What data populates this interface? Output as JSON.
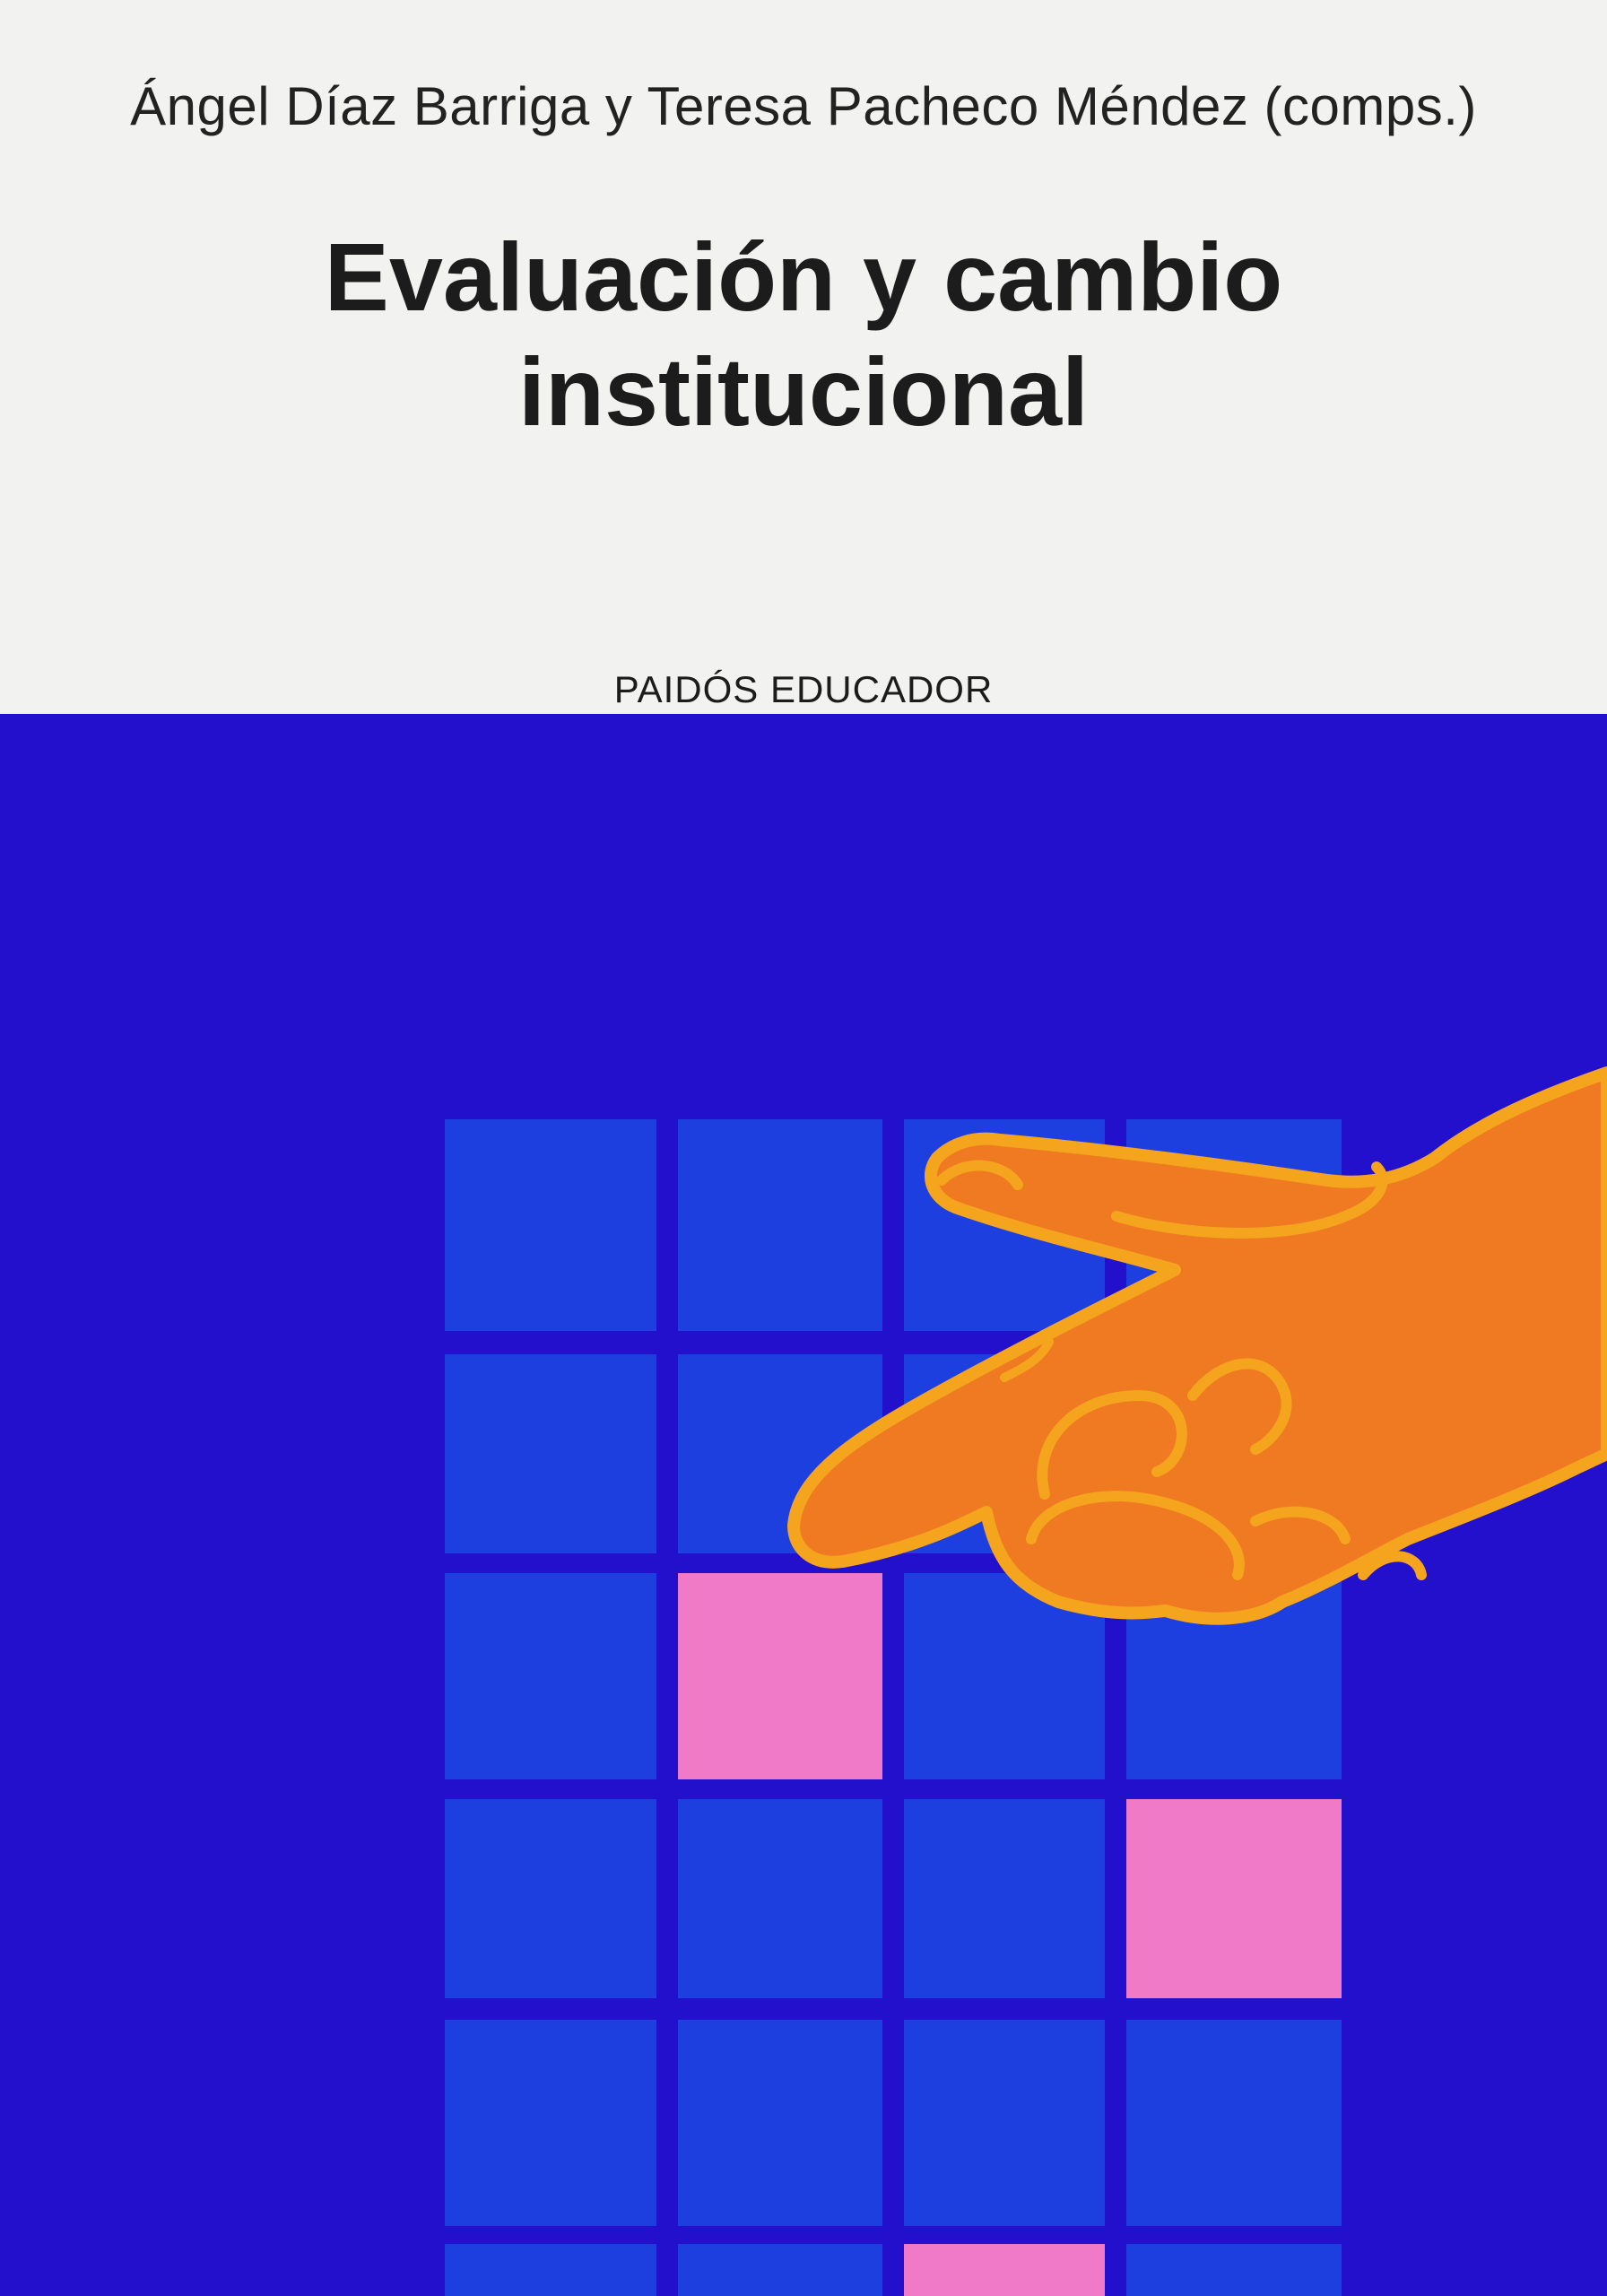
{
  "cover": {
    "authors": "Ángel Díaz Barriga y Teresa Pacheco Méndez (comps.)",
    "title_line1": "Evaluación y cambio",
    "title_line2": "institucional",
    "imprint": "PAIDÓS EDUCADOR"
  },
  "colors": {
    "top_background": "#f2f2f0",
    "blue_background": "#2210cc",
    "square_blue": "#1e3fe0",
    "square_pink": "#f07ac8",
    "hand_fill": "#ef7a22",
    "hand_outline": "#f5a41e"
  },
  "grid": {
    "columns": 4,
    "rows": 6,
    "pink_cells": [
      [
        2,
        1
      ],
      [
        3,
        3
      ],
      [
        5,
        2
      ]
    ]
  }
}
